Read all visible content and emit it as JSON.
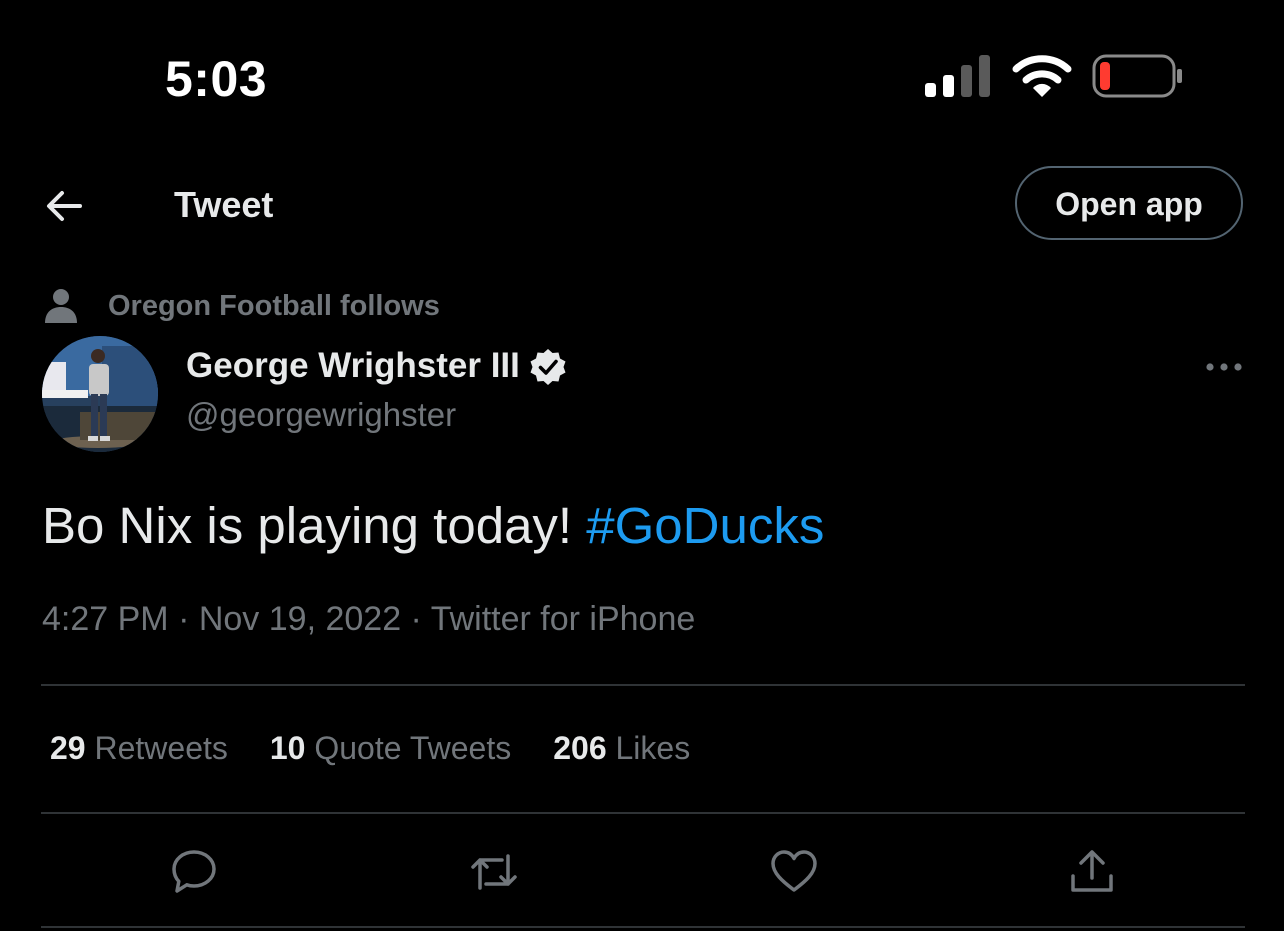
{
  "status_bar": {
    "time": "5:03",
    "battery_color": "#ff3b30"
  },
  "header": {
    "title": "Tweet",
    "open_app_label": "Open app",
    "back_icon": "arrow-left-icon"
  },
  "social_context": {
    "icon": "person-icon",
    "text": "Oregon Football follows"
  },
  "author": {
    "name": "George Wrighster III",
    "handle": "@georgewrighster",
    "verified": true,
    "more_icon": "more-icon"
  },
  "tweet": {
    "text": "Bo Nix is playing today! ",
    "hashtag": "#GoDucks",
    "hashtag_color": "#1d9bf0",
    "time": "4:27 PM",
    "separator": " · ",
    "date": "Nov 19, 2022",
    "source": "Twitter for iPhone"
  },
  "stats": {
    "retweets_count": "29",
    "retweets_label": "Retweets",
    "quotes_count": "10",
    "quotes_label": "Quote Tweets",
    "likes_count": "206",
    "likes_label": "Likes"
  },
  "actions": [
    "reply-icon",
    "retweet-icon",
    "like-icon",
    "share-icon"
  ]
}
